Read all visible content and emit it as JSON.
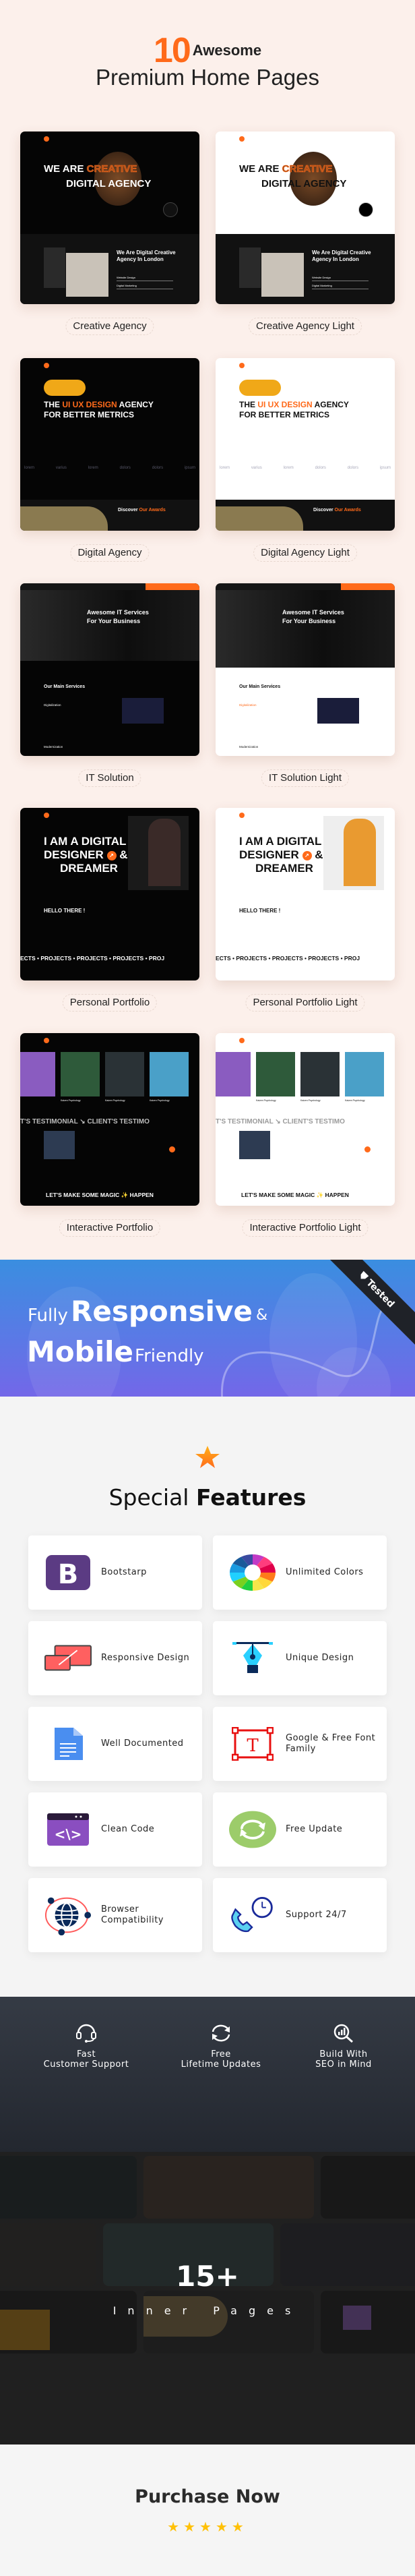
{
  "header": {
    "count": "10",
    "awesome": "Awesome",
    "subtitle": "Premium Home Pages"
  },
  "accent": "#ff6a1a",
  "home_pages": [
    {
      "label": "Creative Agency",
      "theme": "dark",
      "kind": "creative",
      "hero": [
        "WE ARE",
        "CREATIVE",
        "DIGITAL AGENCY"
      ],
      "section": [
        "We Are Digital Creative",
        "Agency In London"
      ],
      "skills": [
        "Website Design",
        "Digital Marketing"
      ]
    },
    {
      "label": "Creative Agency Light",
      "theme": "light",
      "kind": "creative",
      "hero": [
        "WE ARE",
        "CREATIVE",
        "DIGITAL AGENCY"
      ],
      "section": [
        "We Are Digital Creative",
        "Agency In London"
      ],
      "skills": [
        "Website Design",
        "Digital Marketing"
      ]
    },
    {
      "label": "Digital Agency",
      "theme": "dark",
      "kind": "digital",
      "hero": [
        "THE",
        "UI UX DESIGN",
        "AGENCY",
        "FOR BETTER METRICS"
      ],
      "logos": [
        "lorem",
        "varius",
        "lorem",
        "dolors",
        "dolors",
        "ipsum"
      ],
      "section": [
        "Discover",
        "Our Awards"
      ]
    },
    {
      "label": "Digital Agency Light",
      "theme": "light",
      "kind": "digital",
      "hero": [
        "THE",
        "UI UX DESIGN",
        "AGENCY",
        "FOR BETTER METRICS"
      ],
      "logos": [
        "lorem",
        "varius",
        "lorem",
        "dolors",
        "dolors",
        "ipsum"
      ],
      "section": [
        "Discover",
        "Our Awards"
      ]
    },
    {
      "label": "IT Solution",
      "theme": "dark",
      "kind": "it",
      "hero": [
        "Awesome IT Services",
        "For Your Business"
      ],
      "section": [
        "Our Main Services",
        "Digitalization",
        "Modernization"
      ]
    },
    {
      "label": "IT Solution Light",
      "theme": "light",
      "kind": "it",
      "hero": [
        "Awesome IT Services",
        "For Your Business"
      ],
      "section": [
        "Our Main Services",
        "Digitalization",
        "Modernization"
      ]
    },
    {
      "label": "Personal Portfolio",
      "theme": "dark",
      "kind": "personal",
      "hero": [
        "I AM A DIGITAL",
        "DESIGNER",
        "&",
        "DREAMER"
      ],
      "section": [
        "HELLO THERE !"
      ],
      "marquee": "ECTS • PROJECTS • PROJECTS • PROJECTS • PROJ"
    },
    {
      "label": "Personal Portfolio Light",
      "theme": "light",
      "kind": "personal",
      "hero": [
        "I AM A DIGITAL",
        "DESIGNER",
        "&",
        "DREAMER"
      ],
      "section": [
        "HELLO THERE !"
      ],
      "marquee": "ECTS • PROJECTS • PROJECTS • PROJECTS • PROJ"
    },
    {
      "label": "Interactive Portfolio",
      "theme": "dark",
      "kind": "interactive",
      "cards": [
        "Kaizen Psychology",
        "Kaizen Psychology",
        "Kaizen Psychology"
      ],
      "marquee": "T'S TESTIMONIAL ↘ CLIENT'S TESTIMO",
      "section": [
        "LET'S MAKE SOME MAGIC ✨ HAPPEN"
      ]
    },
    {
      "label": "Interactive Portfolio Light",
      "theme": "light",
      "kind": "interactive",
      "cards": [
        "Kaizen Psychology",
        "Kaizen Psychology",
        "Kaizen Psychology"
      ],
      "marquee": "T'S TESTIMONIAL ↘ CLIENT'S TESTIMO",
      "section": [
        "LET'S MAKE SOME MAGIC ✨ HAPPEN"
      ]
    }
  ],
  "banner": {
    "fully": "Fully",
    "responsive": "Responsive",
    "amp": "&",
    "mobile": "Mobile",
    "friendly": "Friendly",
    "ribbon": "Tested"
  },
  "features": {
    "title_regular": "Special",
    "title_bold": "Features",
    "items": [
      {
        "label": "Bootstarp",
        "icon": "bootstrap-icon"
      },
      {
        "label": "Unlimited Colors",
        "icon": "color-wheel-icon"
      },
      {
        "label": "Responsive Design",
        "icon": "responsive-devices-icon"
      },
      {
        "label": "Unique Design",
        "icon": "pen-tool-icon"
      },
      {
        "label": "Well Documented",
        "icon": "document-icon"
      },
      {
        "label": "Google & Free Font Family",
        "icon": "font-icon"
      },
      {
        "label": "Clean Code",
        "icon": "code-window-icon"
      },
      {
        "label": "Free Update",
        "icon": "refresh-icon"
      },
      {
        "label": "Browser Compatibility",
        "icon": "globe-icon"
      },
      {
        "label": "Support 24/7",
        "icon": "phone-clock-icon"
      }
    ]
  },
  "benefits": [
    {
      "line1": "Fast",
      "line2": "Customer Support",
      "icon": "headset-icon"
    },
    {
      "line1": "Free",
      "line2": "Lifetime Updates",
      "icon": "refresh-icon"
    },
    {
      "line1": "Build With",
      "line2": "SEO in Mind",
      "icon": "seo-search-icon"
    }
  ],
  "inner_pages": {
    "count": "15+",
    "label": "Inner Pages"
  },
  "purchase": {
    "label": "Purchase Now",
    "rating": 5,
    "star_color": "#ffc107"
  }
}
